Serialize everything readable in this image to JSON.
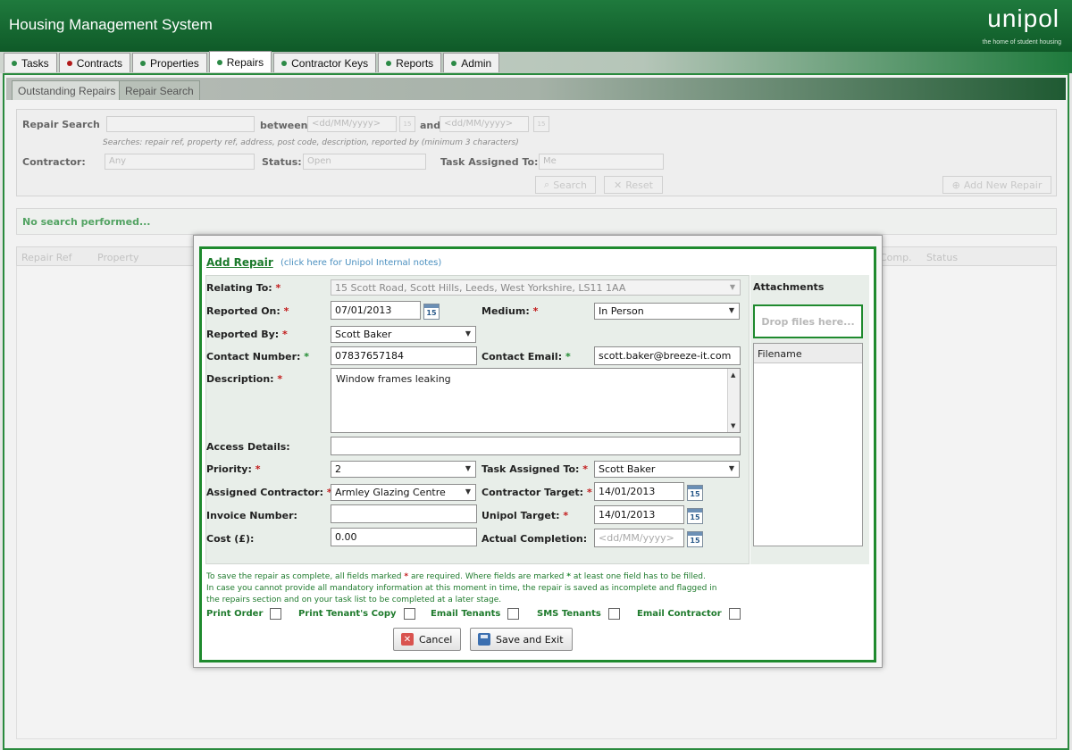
{
  "app": {
    "title": "Housing Management System",
    "logo": "unipol",
    "logo_tagline": "the home of student housing"
  },
  "main_tabs": [
    {
      "label": "Tasks",
      "dot": "#2c8a46"
    },
    {
      "label": "Contracts",
      "dot": "#b21a1a"
    },
    {
      "label": "Properties",
      "dot": "#2c8a46"
    },
    {
      "label": "Repairs",
      "dot": "#2c8a46",
      "active": true
    },
    {
      "label": "Contractor Keys",
      "dot": "#2c8a46"
    },
    {
      "label": "Reports",
      "dot": "#2c8a46"
    },
    {
      "label": "Admin",
      "dot": "#2c8a46"
    }
  ],
  "sub_tabs": [
    {
      "label": "Outstanding Repairs"
    },
    {
      "label": "Repair Search",
      "active": true
    }
  ],
  "search": {
    "label": "Repair Search",
    "between_label": "between",
    "and_label": "and",
    "date_placeholder": "<dd/MM/yyyy>",
    "hint": "Searches: repair ref, property ref, address, post code, description, reported by (minimum 3 characters)",
    "contractor_label": "Contractor:",
    "contractor_value": "Any",
    "status_label": "Status:",
    "status_value": "Open",
    "task_assigned_label": "Task Assigned To:",
    "task_assigned_value": "Me",
    "search_button": "Search",
    "reset_button": "Reset",
    "add_new_button": "Add New Repair"
  },
  "no_search_text": "No search performed...",
  "results_columns": [
    "Repair Ref",
    "Property",
    "Comp.",
    "Status"
  ],
  "modal": {
    "title": "Add Repair",
    "internal_note_link": "(click here for Unipol Internal notes)",
    "fields": {
      "relating_to": {
        "label": "Relating To:",
        "value": "15 Scott Road, Scott Hills, Leeds, West Yorkshire, LS11 1AA"
      },
      "reported_on": {
        "label": "Reported On:",
        "value": "07/01/2013"
      },
      "medium": {
        "label": "Medium:",
        "value": "In Person"
      },
      "reported_by": {
        "label": "Reported By:",
        "value": "Scott Baker"
      },
      "contact_number": {
        "label": "Contact Number:",
        "value": "07837657184"
      },
      "contact_email": {
        "label": "Contact Email:",
        "value": "scott.baker@breeze-it.com"
      },
      "description": {
        "label": "Description:",
        "value": "Window frames leaking"
      },
      "access_details": {
        "label": "Access Details:",
        "value": ""
      },
      "priority": {
        "label": "Priority:",
        "value": "2"
      },
      "task_assigned_to": {
        "label": "Task Assigned To:",
        "value": "Scott Baker"
      },
      "assigned_contractor": {
        "label": "Assigned Contractor:",
        "value": "Armley Glazing Centre"
      },
      "contractor_target": {
        "label": "Contractor Target:",
        "value": "14/01/2013"
      },
      "invoice_number": {
        "label": "Invoice Number:",
        "value": ""
      },
      "unipol_target": {
        "label": "Unipol Target:",
        "value": "14/01/2013"
      },
      "cost": {
        "label": "Cost (£):",
        "value": "0.00"
      },
      "actual_completion": {
        "label": "Actual Completion:",
        "placeholder": "<dd/MM/yyyy>"
      }
    },
    "attachments": {
      "title": "Attachments",
      "drop_text": "Drop files here...",
      "column": "Filename"
    },
    "footnotes": {
      "line1_a": "To save the repair as complete, all fields marked",
      "line1_b": "are required. Where fields are marked",
      "line1_c": "at least one field has to be filled.",
      "line2": "In case you cannot provide all mandatory information at this moment in time, the repair is saved as incomplete and flagged in",
      "line3": "the repairs section and on your task list to be completed at a later stage."
    },
    "options": [
      "Print Order",
      "Print Tenant's Copy",
      "Email Tenants",
      "SMS Tenants",
      "Email Contractor"
    ],
    "cancel_button": "Cancel",
    "save_button": "Save and Exit",
    "calendar_day": "15"
  }
}
